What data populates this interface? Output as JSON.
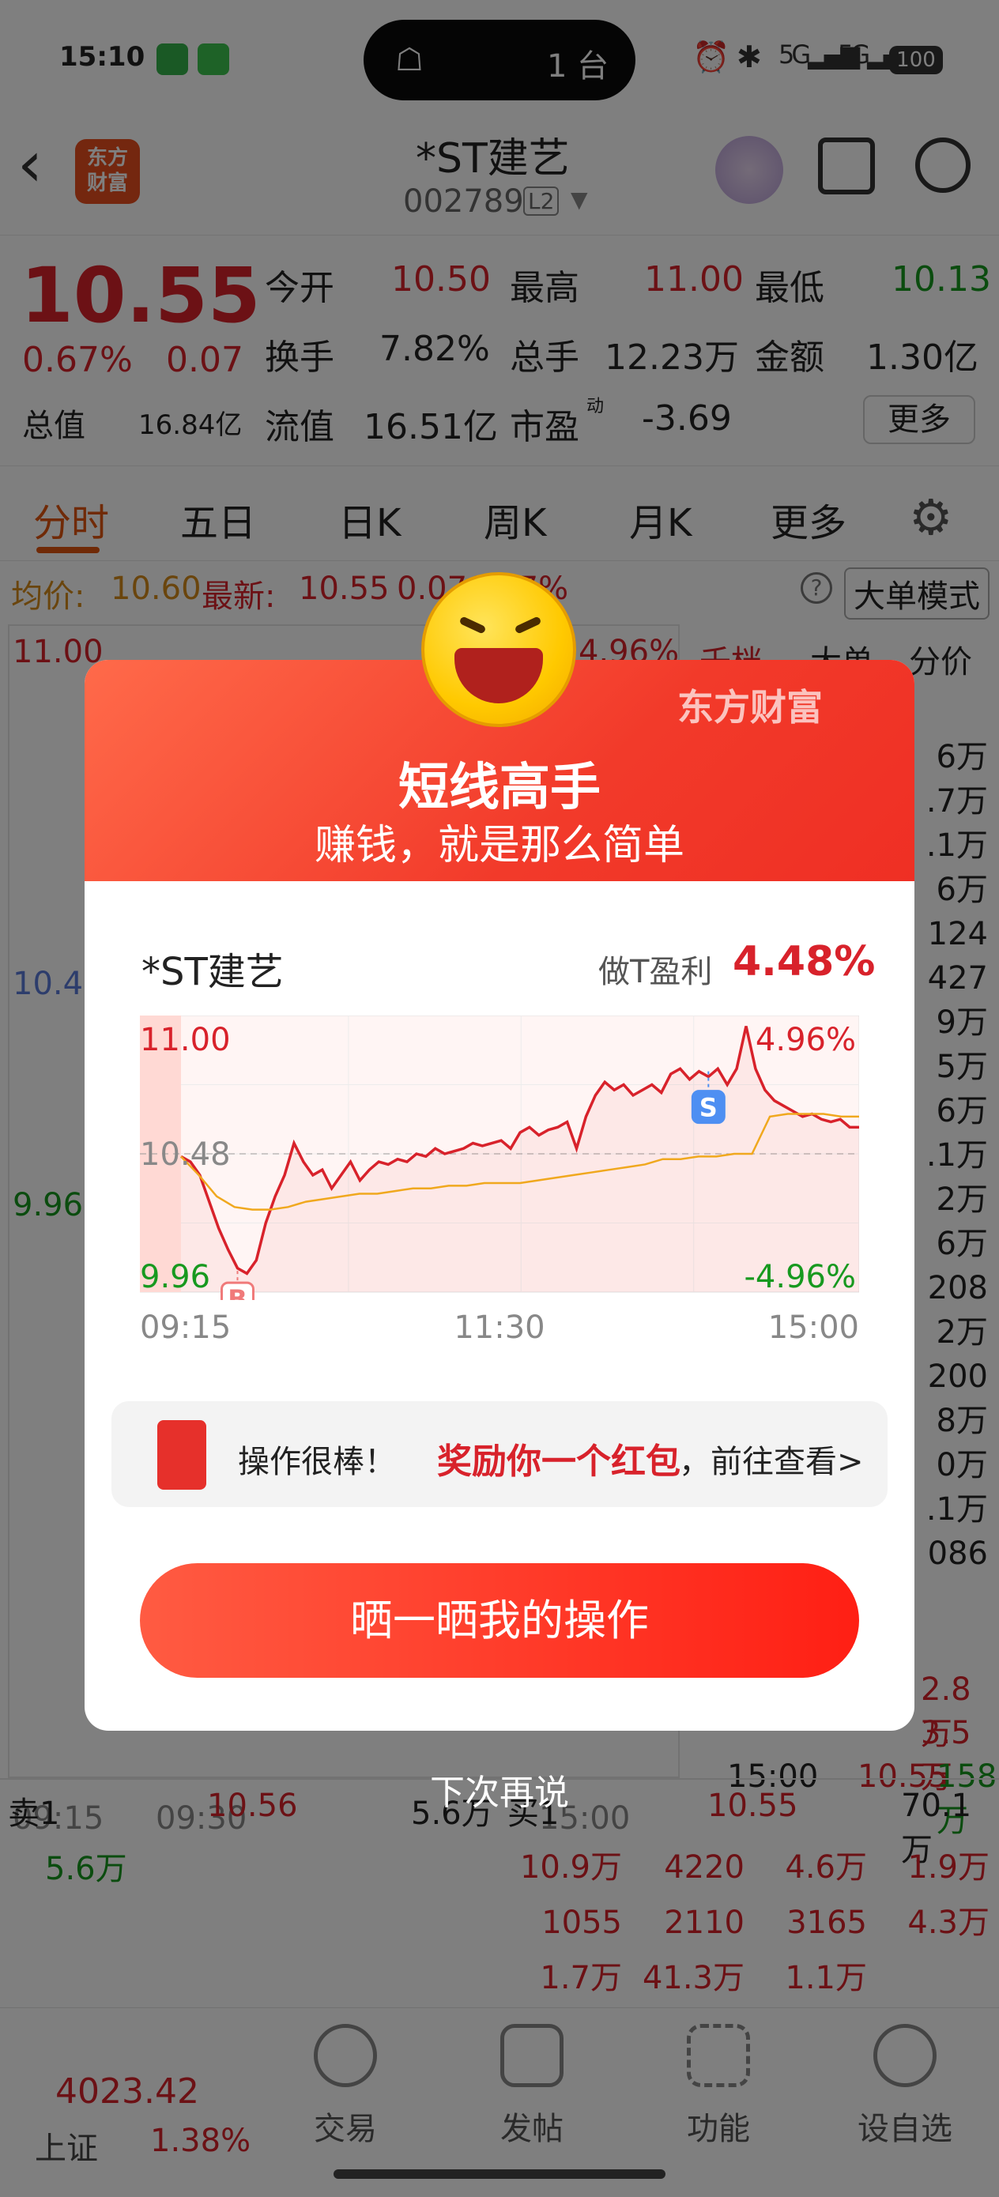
{
  "status": {
    "time": "15:10",
    "island_count": "1 台",
    "battery": "100"
  },
  "header": {
    "logo": "东方\n财富",
    "name": "*ST建艺",
    "code": "002789",
    "level": "L2"
  },
  "quote": {
    "price": "10.55",
    "pct": "0.67%",
    "chg": "0.07",
    "open_label": "今开",
    "open": "10.50",
    "high_label": "最高",
    "high": "11.00",
    "low_label": "最低",
    "low": "10.13",
    "turnover_label": "换手",
    "turnover": "7.82%",
    "vol_label": "总手",
    "vol": "12.23万",
    "amt_label": "金额",
    "amt": "1.30亿",
    "mcap_label": "总值",
    "mcap": "16.84亿",
    "float_label": "流值",
    "float": "16.51亿",
    "pe_label": "市盈",
    "pe_sup": "动",
    "pe": "-3.69",
    "more": "更多"
  },
  "tabs": [
    "分时",
    "五日",
    "日K",
    "周K",
    "月K",
    "更多"
  ],
  "info": {
    "avg_label": "均价:",
    "avg": "10.60",
    "latest_label": "最新:",
    "latest": "10.55",
    "latest_chg": "0.07",
    "latest_pct": "0.67%",
    "big_order": "大单模式"
  },
  "bg_chart": {
    "top": "11.00",
    "mid": "10.48",
    "bottom": "9.96",
    "top_pct": "4.96%",
    "t_start": "09:15",
    "t_mid": "09:30",
    "t_end": "15:00"
  },
  "side_tabs": [
    "千档",
    "大单",
    "分价"
  ],
  "side_vals": [
    "6万",
    ".7万",
    ".1万",
    "6万",
    "124",
    "427",
    "9万",
    "5万",
    "6万",
    ".1万",
    "2万",
    "6万",
    "208",
    "2万",
    "200",
    "8万",
    "0万",
    ".1万",
    "086"
  ],
  "side_bottom": {
    "v1": "2.8万",
    "v2": "3.5万",
    "time": "15:00",
    "price": "10.55",
    "vol": "158万"
  },
  "order_book": {
    "sell_label": "卖1",
    "sell_price": "10.56",
    "sell_vol": "5.6万",
    "sell_sub": "5.6万",
    "buy_label": "买1",
    "buy_price": "10.55",
    "buy_vol": "70.1万",
    "rows": [
      [
        "10.9万",
        "4220",
        "4.6万",
        "1.9万"
      ],
      [
        "1055",
        "2110",
        "3165",
        "4.3万"
      ],
      [
        "1.7万",
        "41.3万",
        "1.1万",
        ""
      ]
    ]
  },
  "bottom_nav": {
    "index_value": "4023.42",
    "index_name": "上证",
    "index_pct": "1.38%",
    "items": [
      "交易",
      "发帖",
      "功能",
      "设自选"
    ]
  },
  "modal": {
    "brand": "东方财富",
    "title": "短线高手",
    "subtitle": "赚钱，就是那么简单",
    "stock": "*ST建艺",
    "profit_label": "做T盈利",
    "profit": "4.48%",
    "gift_text_a": "操作很棒！",
    "gift_text_b": "奖励你一个红包",
    "gift_text_c": "，前往查看>",
    "share": "晒一晒我的操作",
    "dismiss": "下次再说"
  },
  "chart_data": {
    "type": "line",
    "title": "",
    "xlabel": "",
    "ylabel": "",
    "x_ticks": [
      "09:15",
      "11:30",
      "15:00"
    ],
    "ylim": [
      9.96,
      11.0
    ],
    "y_ticks": [
      "11.00",
      "10.48",
      "9.96"
    ],
    "right_ticks": [
      "4.96%",
      "-4.96%"
    ],
    "reference": 10.48,
    "markers": [
      {
        "label": "B",
        "price": 10.04
      },
      {
        "label": "S",
        "price": 10.79
      }
    ],
    "series": [
      {
        "values": [
          10.47,
          10.45,
          10.4,
          10.3,
          10.2,
          10.12,
          10.05,
          10.03,
          10.08,
          10.22,
          10.32,
          10.4,
          10.52,
          10.45,
          10.4,
          10.42,
          10.35,
          10.4,
          10.45,
          10.38,
          10.42,
          10.45,
          10.44,
          10.46,
          10.45,
          10.48,
          10.47,
          10.5,
          10.48,
          10.49,
          10.5,
          10.52,
          10.51,
          10.52,
          10.53,
          10.5,
          10.56,
          10.58,
          10.55,
          10.57,
          10.58,
          10.6,
          10.5,
          10.62,
          10.7,
          10.75,
          10.72,
          10.74,
          10.7,
          10.72,
          10.74,
          10.71,
          10.78,
          10.8,
          10.76,
          10.79,
          10.77,
          10.8,
          10.74,
          10.8,
          10.96,
          10.8,
          10.72,
          10.68,
          10.66,
          10.64,
          10.62,
          10.63,
          10.61,
          10.6,
          10.61,
          10.58,
          10.58
        ]
      },
      {
        "values": [
          10.47,
          10.4,
          10.32,
          10.28,
          10.27,
          10.27,
          10.28,
          10.3,
          10.31,
          10.32,
          10.33,
          10.33,
          10.34,
          10.35,
          10.35,
          10.36,
          10.36,
          10.37,
          10.37,
          10.37,
          10.38,
          10.39,
          10.4,
          10.41,
          10.42,
          10.43,
          10.44,
          10.46,
          10.46,
          10.47,
          10.47,
          10.48,
          10.48,
          10.62,
          10.63,
          10.63,
          10.63,
          10.62,
          10.62
        ]
      }
    ]
  }
}
